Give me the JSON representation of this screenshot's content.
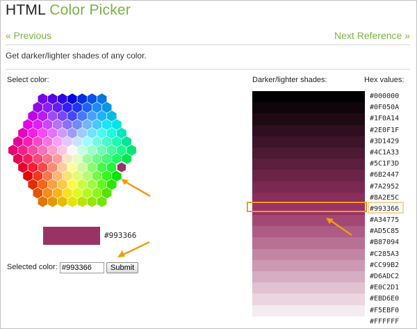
{
  "header": {
    "title_main": "HTML",
    "title_accent": "Color Picker"
  },
  "nav": {
    "previous": "« Previous",
    "next": "Next Reference »"
  },
  "description": "Get darker/lighter shades of any color.",
  "picker": {
    "select_label": "Select color:",
    "current_hex": "#993366",
    "current_color": "#993366",
    "selected_label": "Selected color:",
    "selected_value": "#993366",
    "submit_label": "Submit"
  },
  "shades": {
    "title": "Darker/lighter shades:",
    "hex_title": "Hex values:",
    "selected_index": 10,
    "values": [
      "#000000",
      "#0F050A",
      "#1F0A14",
      "#2E0F1F",
      "#3D1429",
      "#4C1A33",
      "#5C1F3D",
      "#6B2447",
      "#7A2952",
      "#8A2E5C",
      "#993366",
      "#A34775",
      "#AD5C85",
      "#B87094",
      "#C285A3",
      "#CC99B2",
      "#D6ADC2",
      "#E0C2D1",
      "#EBD6E0",
      "#F5EBF0",
      "#FFFFFF"
    ]
  },
  "colors": {
    "accent": "#7cb342",
    "highlight": "#f39c12"
  }
}
